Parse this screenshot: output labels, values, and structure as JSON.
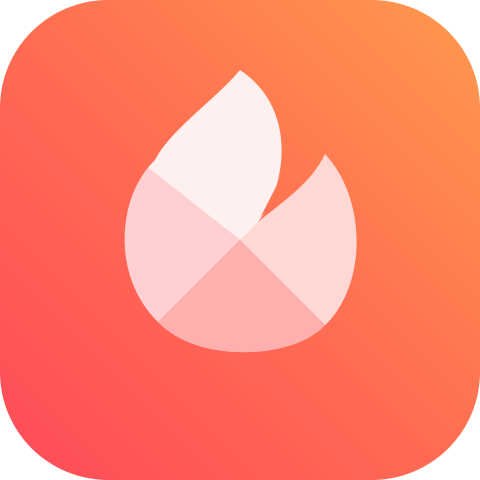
{
  "app_icon": {
    "icon": "flame-icon",
    "colors": {
      "gradient_top_right": "#FF9A4E",
      "gradient_mid": "#FF7151",
      "gradient_bottom_left": "#FF4A5A",
      "flame_top_petal": "#FFF0F0",
      "flame_left_petal": "#FFD0D2",
      "flame_right_petal": "#FFD8D6",
      "flame_bottom_petal": "#FFB0AE"
    }
  }
}
